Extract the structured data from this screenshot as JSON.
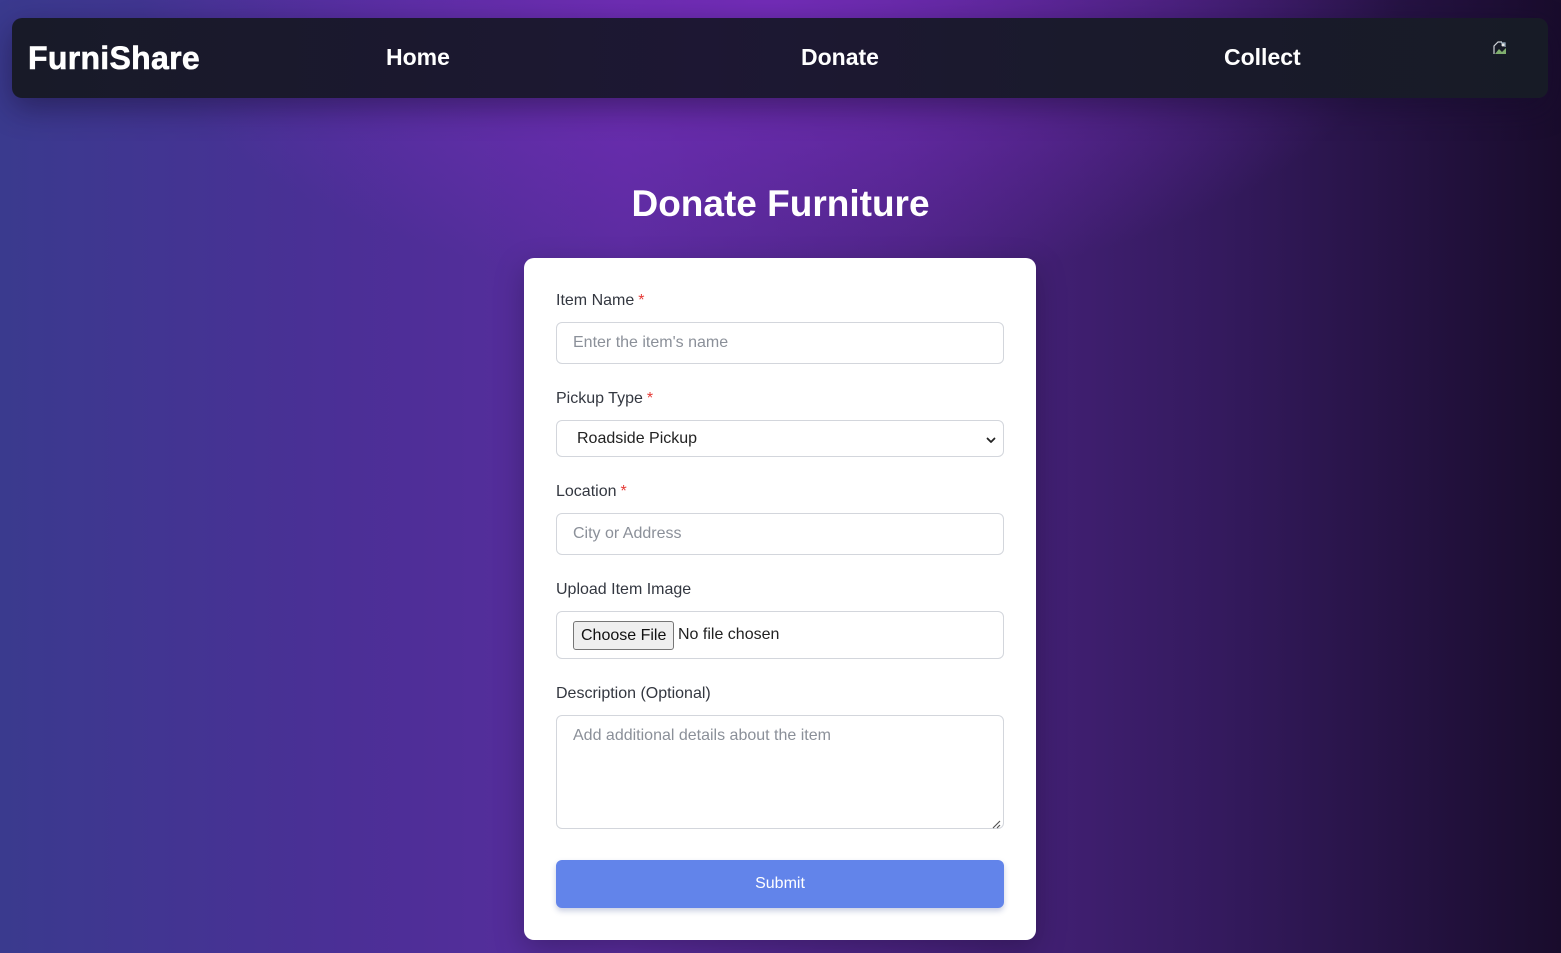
{
  "navbar": {
    "brand": "FurniShare",
    "links": [
      {
        "label": "Home"
      },
      {
        "label": "Donate"
      },
      {
        "label": "Collect"
      }
    ],
    "avatar_icon": "broken-image-icon"
  },
  "page": {
    "title": "Donate Furniture"
  },
  "form": {
    "item_name": {
      "label": "Item Name",
      "required_mark": "*",
      "value": "",
      "placeholder": "Enter the item's name"
    },
    "pickup_type": {
      "label": "Pickup Type",
      "required_mark": "*",
      "selected": "Roadside Pickup"
    },
    "location": {
      "label": "Location",
      "required_mark": "*",
      "value": "",
      "placeholder": "City or Address"
    },
    "upload": {
      "label": "Upload Item Image",
      "button_label": "Choose File",
      "status": "No file chosen"
    },
    "description": {
      "label": "Description (Optional)",
      "value": "",
      "placeholder": "Add additional details about the item"
    },
    "submit_label": "Submit"
  },
  "colors": {
    "submit_button": "#6284ea",
    "required_mark": "#e53935",
    "navbar_bg": "#1b1a2e",
    "card_bg": "#ffffff"
  }
}
